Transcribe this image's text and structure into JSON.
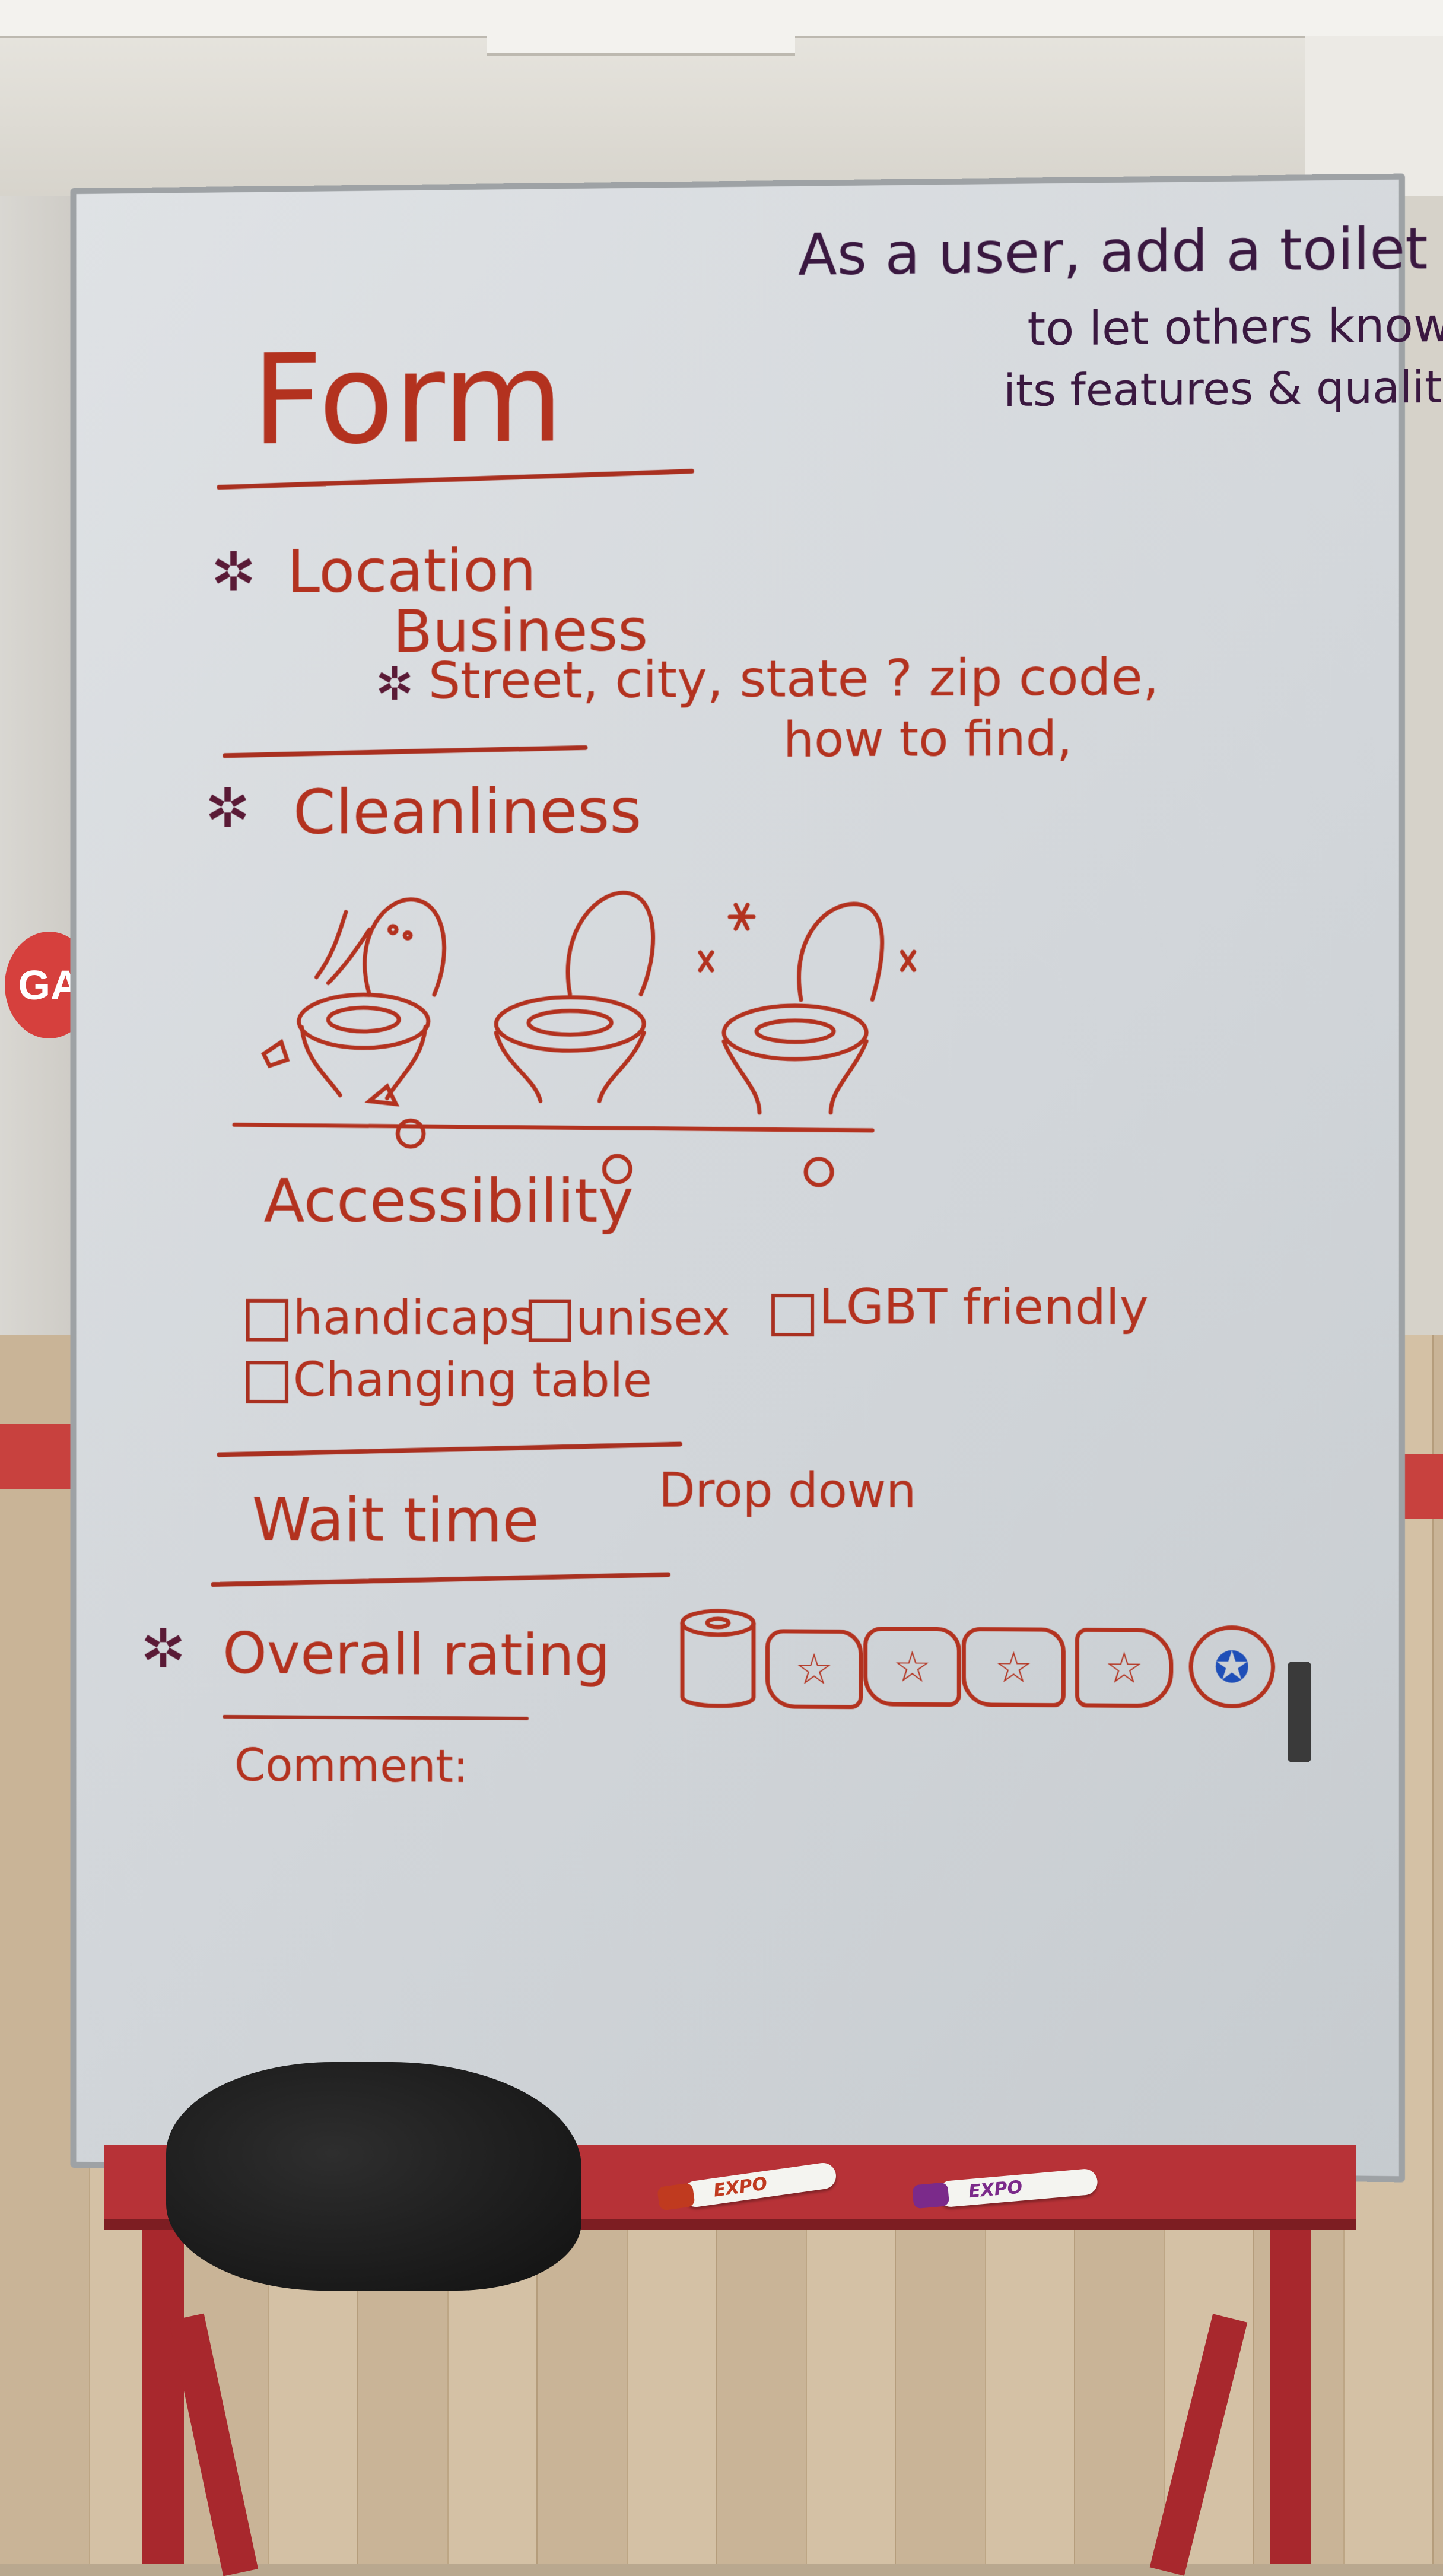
{
  "sign": {
    "logo_text": "GA"
  },
  "board": {
    "user_story": {
      "line1": "As a user, add a toilet",
      "line2": "to let others know",
      "line3": "its features & quality"
    },
    "title": "Form",
    "location": {
      "label": "Location",
      "business": "Business",
      "address_fields": "Street, city, state ? zip code,",
      "how_to_find": "how to find,"
    },
    "cleanliness": {
      "label": "Cleanliness"
    },
    "accessibility": {
      "label": "Accessibility",
      "options": [
        "handicaps",
        "unisex",
        "LGBT friendly",
        "Changing table"
      ]
    },
    "wait_time": {
      "label": "Wait time",
      "note": "Drop down"
    },
    "overall_rating": {
      "label": "Overall rating"
    },
    "comment": {
      "label": "Comment:"
    }
  },
  "markers": [
    {
      "brand": "EXPO",
      "color": "#c03a1f"
    },
    {
      "brand": "EXPO",
      "color": "#7b2a8a"
    }
  ],
  "colors": {
    "ink_red": "#b3321f",
    "ink_purple": "#3a1840",
    "ink_blue": "#1f4fb8",
    "easel_red": "#b73237"
  }
}
